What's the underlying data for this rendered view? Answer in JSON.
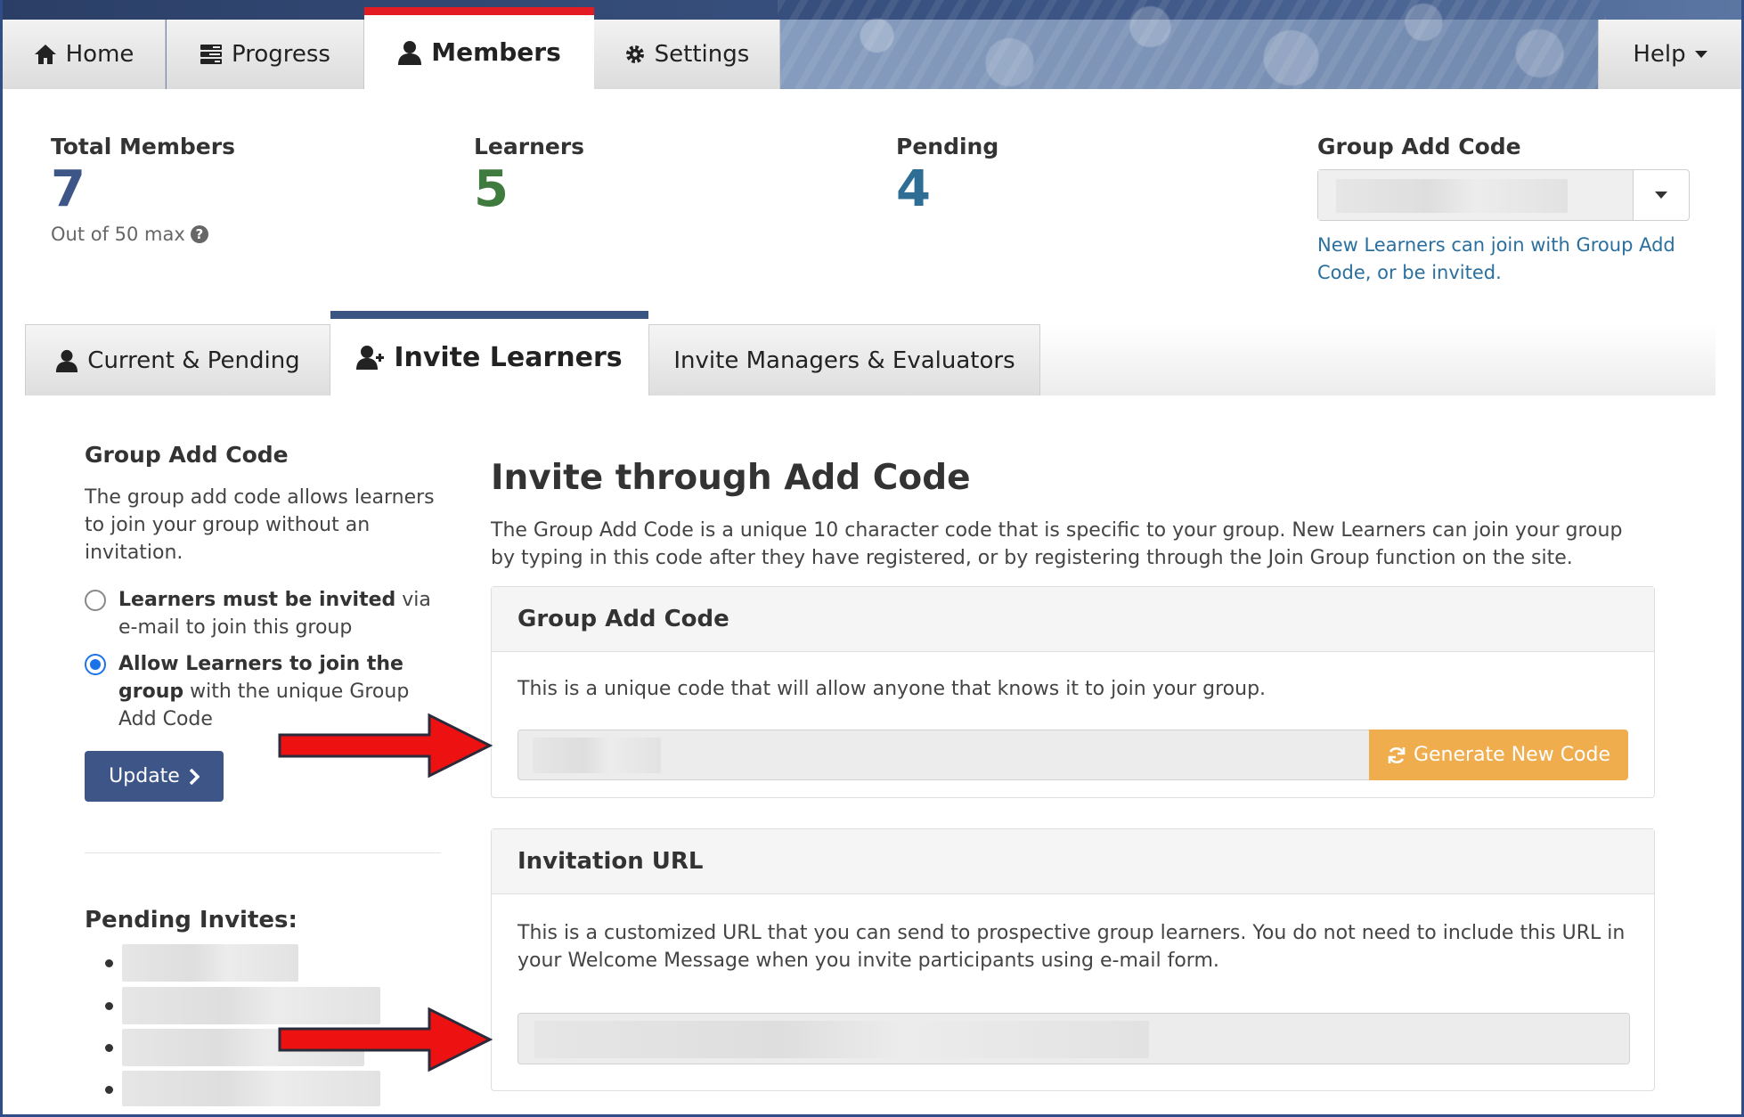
{
  "nav": {
    "tabs": [
      {
        "label": "Home",
        "icon": "home-icon"
      },
      {
        "label": "Progress",
        "icon": "progress-icon"
      },
      {
        "label": "Members",
        "icon": "user-icon",
        "active": true
      },
      {
        "label": "Settings",
        "icon": "gear-icon"
      }
    ],
    "help_label": "Help",
    "accent_color": "#e31b23"
  },
  "stats": {
    "total_members": {
      "label": "Total Members",
      "value": "7",
      "sub": "Out of 50 max",
      "color": "#3d5687"
    },
    "learners": {
      "label": "Learners",
      "value": "5",
      "color": "#3f7a3f"
    },
    "pending": {
      "label": "Pending",
      "value": "4",
      "color": "#2f6e94"
    },
    "group_add_code": {
      "label": "Group Add Code",
      "note": "New Learners can join with Group Add Code, or be invited."
    }
  },
  "tabs": [
    {
      "label": "Current & Pending",
      "icon": "user-icon"
    },
    {
      "label": "Invite Learners",
      "icon": "user-plus-icon",
      "active": true
    },
    {
      "label": "Invite Managers & Evaluators"
    }
  ],
  "sidebar": {
    "title": "Group Add Code",
    "description": "The group add code allows learners to join your group without an invitation.",
    "option_invited_bold": "Learners must be invited",
    "option_invited_rest": " via e-mail to join this group",
    "option_allow_bold": "Allow Learners to join the group",
    "option_allow_rest": " with the unique Group Add Code",
    "selected_option": "allow",
    "update_label": "Update",
    "pending_title": "Pending Invites:"
  },
  "main": {
    "title": "Invite through Add Code",
    "description": "The Group Add Code is a unique 10 character code that is specific to your group. New Learners can join your group by typing in this code after they have registered, or by registering through the Join Group function on the site.",
    "code_panel": {
      "title": "Group Add Code",
      "text": "This is a unique code that will allow anyone that knows it to join your group.",
      "generate_label": "Generate New Code",
      "button_color": "#f0ad4e"
    },
    "url_panel": {
      "title": "Invitation URL",
      "text": "This is a customized URL that you can send to prospective group learners. You do not need to include this URL in your Welcome Message when you invite participants using e-mail form."
    }
  }
}
